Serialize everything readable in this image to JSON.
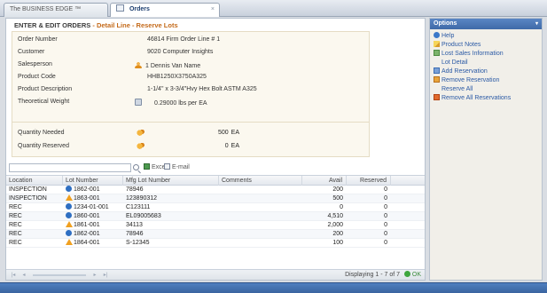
{
  "tabs": [
    {
      "label": "The BUSINESS EDGE ™"
    },
    {
      "label": "Orders"
    }
  ],
  "panel": {
    "title": "ENTER & EDIT ORDERS",
    "subtitle": "- Detail Line - Reserve Lots"
  },
  "detail": {
    "order_number": {
      "label": "Order Number",
      "value": "46814 Firm Order Line # 1"
    },
    "customer": {
      "label": "Customer",
      "value": "9020 Computer Insights"
    },
    "salesperson": {
      "label": "Salesperson",
      "value": "1 Dennis Van Name"
    },
    "product_code": {
      "label": "Product Code",
      "value": "HHB1250X3750A325"
    },
    "product_description": {
      "label": "Product Description",
      "value": "1-1/4\" x 3-3/4\"Hvy Hex Bolt ASTM A325"
    },
    "theoretical_weight": {
      "label": "Theoretical Weight",
      "value": "0.29000 lbs per EA"
    }
  },
  "quantity": {
    "needed": {
      "label": "Quantity Needed",
      "value": "500",
      "unit": "EA"
    },
    "reserved": {
      "label": "Quantity Reserved",
      "value": "0",
      "unit": "EA"
    }
  },
  "toolbar": {
    "search_placeholder": "",
    "excel_label": "Excel",
    "email_label": "E-mail"
  },
  "grid": {
    "headers": {
      "location": "Location",
      "lot_number": "Lot Number",
      "mfg_lot_number": "Mfg Lot Number",
      "comments": "Comments",
      "avail": "Avail",
      "reserved": "Reserved"
    },
    "rows": [
      {
        "location": "INSPECTION",
        "lot_icon": "info",
        "lot_number": "1862-001",
        "mfg_lot_number": "78946",
        "comments": "",
        "avail": "200",
        "reserved": "0"
      },
      {
        "location": "INSPECTION",
        "lot_icon": "warning",
        "lot_number": "1863-001",
        "mfg_lot_number": "123890312",
        "comments": "",
        "avail": "500",
        "reserved": "0"
      },
      {
        "location": "REC",
        "lot_icon": "info",
        "lot_number": "1234-01-001",
        "mfg_lot_number": "C123111",
        "comments": "",
        "avail": "0",
        "reserved": "0"
      },
      {
        "location": "REC",
        "lot_icon": "info",
        "lot_number": "1860-001",
        "mfg_lot_number": "EL09005683",
        "comments": "",
        "avail": "4,510",
        "reserved": "0"
      },
      {
        "location": "REC",
        "lot_icon": "warning",
        "lot_number": "1861-001",
        "mfg_lot_number": "34113",
        "comments": "",
        "avail": "2,000",
        "reserved": "0"
      },
      {
        "location": "REC",
        "lot_icon": "info",
        "lot_number": "1862-001",
        "mfg_lot_number": "78946",
        "comments": "",
        "avail": "200",
        "reserved": "0"
      },
      {
        "location": "REC",
        "lot_icon": "warning",
        "lot_number": "1864-001",
        "mfg_lot_number": "S-12345",
        "comments": "",
        "avail": "100",
        "reserved": "0"
      }
    ]
  },
  "paging": {
    "info": "Displaying 1 - 7 of 7",
    "ok_label": "OK"
  },
  "options": {
    "title": "Options",
    "items": [
      {
        "label": "Help",
        "icon": "help-icon",
        "indent": false
      },
      {
        "label": "Product Notes",
        "icon": "note-icon",
        "indent": false
      },
      {
        "label": "Lost Sales Information",
        "icon": "lost-sales-icon",
        "indent": false
      },
      {
        "label": "Lot Detail",
        "icon": "",
        "indent": true
      },
      {
        "label": "Add Reservation",
        "icon": "add-icon",
        "indent": false
      },
      {
        "label": "Remove Reservation",
        "icon": "remove-icon",
        "indent": false
      },
      {
        "label": "Reserve All",
        "icon": "",
        "indent": true
      },
      {
        "label": "Remove All Reservations",
        "icon": "remove-all-icon",
        "indent": false
      }
    ]
  },
  "colors": {
    "accent": "#3f6aa8",
    "subtitle": "#c46a1a",
    "link": "#2b5aa5",
    "panel_bg": "#fbf8ef"
  }
}
